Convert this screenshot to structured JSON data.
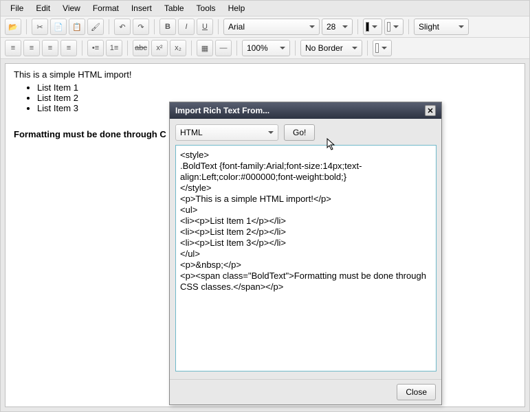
{
  "menu": [
    "File",
    "Edit",
    "View",
    "Format",
    "Insert",
    "Table",
    "Tools",
    "Help"
  ],
  "toolbar1": {
    "font": "Arial",
    "fontsize": "28",
    "fontcolor": "#000000",
    "fillcolor": "#ffffff",
    "hinting": "Slight"
  },
  "toolbar2": {
    "zoom": "100%",
    "border": "No Border"
  },
  "document": {
    "p1": "This is a simple HTML import!",
    "list": [
      "List Item 1",
      "List Item 2",
      "List Item 3"
    ],
    "p2": "Formatting must be done through C"
  },
  "dialog": {
    "title": "Import Rich Text From...",
    "format": "HTML",
    "go": "Go!",
    "close": "Close",
    "text": "<style>\n.BoldText {font-family:Arial;font-size:14px;text-align:Left;color:#000000;font-weight:bold;}\n</style>\n<p>This is a simple HTML import!</p>\n<ul>\n<li><p>List Item 1</p></li>\n<li><p>List Item 2</p></li>\n<li><p>List Item 3</p></li>\n</ul>\n<p>&nbsp;</p>\n<p><span class=\"BoldText\">Formatting must be done through CSS classes.</span></p>"
  }
}
